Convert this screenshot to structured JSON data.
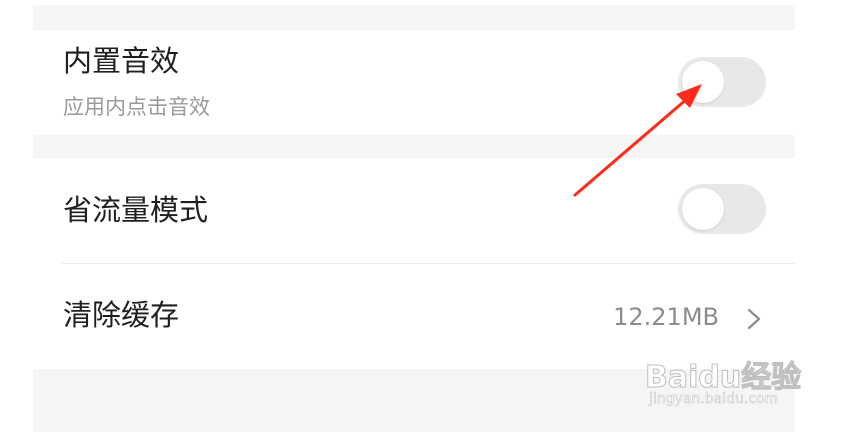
{
  "settings": {
    "sound_effects": {
      "title": "内置音效",
      "subtitle": "应用内点击音效",
      "enabled": false
    },
    "data_saver": {
      "title": "省流量模式",
      "enabled": false
    },
    "clear_cache": {
      "title": "清除缓存",
      "value": "12.21MB"
    }
  },
  "watermark": {
    "logo_text": "Baidu经验",
    "url_text": "jingyan.baidu.com"
  },
  "icons": {
    "chevron": "chevron-right-icon",
    "annotation": "red-arrow-icon"
  },
  "colors": {
    "annotation_arrow": "#ff2a1a",
    "toggle_off": "#e8e8e8",
    "background_band": "#f5f5f5"
  }
}
